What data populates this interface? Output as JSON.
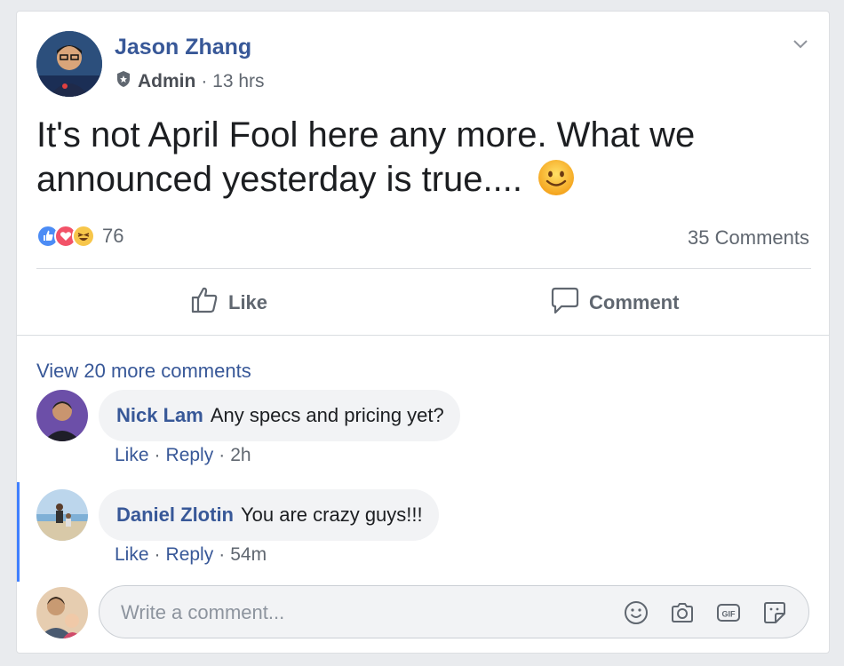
{
  "post": {
    "author": "Jason Zhang",
    "role": "Admin",
    "time": "· 13 hrs",
    "text": "It's not April Fool here any more. What we announced yesterday is true....",
    "reaction_count": "76",
    "comments_count": "35 Comments"
  },
  "actions": {
    "like": "Like",
    "comment": "Comment"
  },
  "comments_section": {
    "view_more": "View 20 more comments",
    "comments": [
      {
        "name": "Nick Lam",
        "text": "Any specs and pricing yet?",
        "like": "Like",
        "reply": "Reply",
        "time": "2h"
      },
      {
        "name": "Daniel Zlotin",
        "text": "You are crazy guys!!!",
        "like": "Like",
        "reply": "Reply",
        "time": "54m"
      }
    ]
  },
  "composer": {
    "placeholder": "Write a comment..."
  },
  "colors": {
    "link": "#385898",
    "accent": "#4080ff"
  }
}
